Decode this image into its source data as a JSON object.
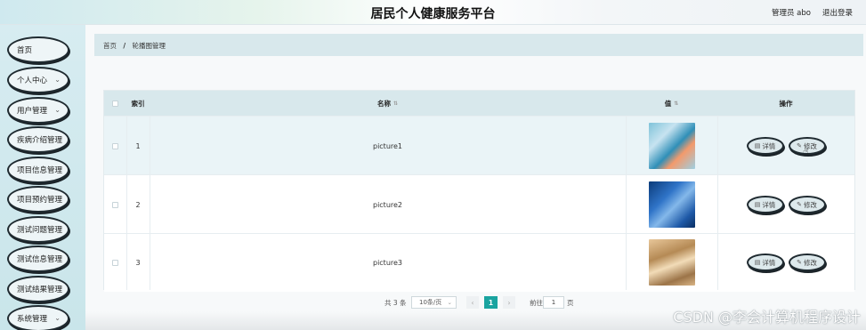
{
  "header": {
    "title": "居民个人健康服务平台",
    "user": "管理员 abo",
    "logout": "退出登录"
  },
  "sidebar": {
    "items": [
      {
        "label": "首页",
        "has_chevron": false
      },
      {
        "label": "个人中心",
        "has_chevron": true
      },
      {
        "label": "用户管理",
        "has_chevron": true
      },
      {
        "label": "疾病介绍管理",
        "has_chevron": false
      },
      {
        "label": "项目信息管理",
        "has_chevron": false
      },
      {
        "label": "项目预约管理",
        "has_chevron": false
      },
      {
        "label": "测试问题管理",
        "has_chevron": false
      },
      {
        "label": "测试信息管理",
        "has_chevron": false
      },
      {
        "label": "测试结果管理",
        "has_chevron": false
      },
      {
        "label": "系统管理",
        "has_chevron": true
      }
    ],
    "chevron": "⌄"
  },
  "breadcrumb": {
    "home": "首页",
    "separator": "/",
    "current": "轮播图管理"
  },
  "table": {
    "headers": {
      "index": "索引",
      "name": "名称",
      "value": "值",
      "actions": "操作"
    },
    "rows": [
      {
        "index": "1",
        "name": "picture1",
        "detail": "详情",
        "edit": "修改"
      },
      {
        "index": "2",
        "name": "picture2",
        "detail": "详情",
        "edit": "修改"
      },
      {
        "index": "3",
        "name": "picture3",
        "detail": "详情",
        "edit": "修改"
      }
    ]
  },
  "pagination": {
    "total": "共 3 条",
    "page_size": "10条/页",
    "prev": "‹",
    "current_page": "1",
    "next": "›",
    "goto_label": "前往",
    "goto_value": "1",
    "page_suffix": "页"
  },
  "watermark": "CSDN @李会计算机程序设计",
  "colors": {
    "accent": "#1aa4a0",
    "header_bg": "#d8e8ec",
    "sidebar_bg": "#cfe8ed"
  }
}
